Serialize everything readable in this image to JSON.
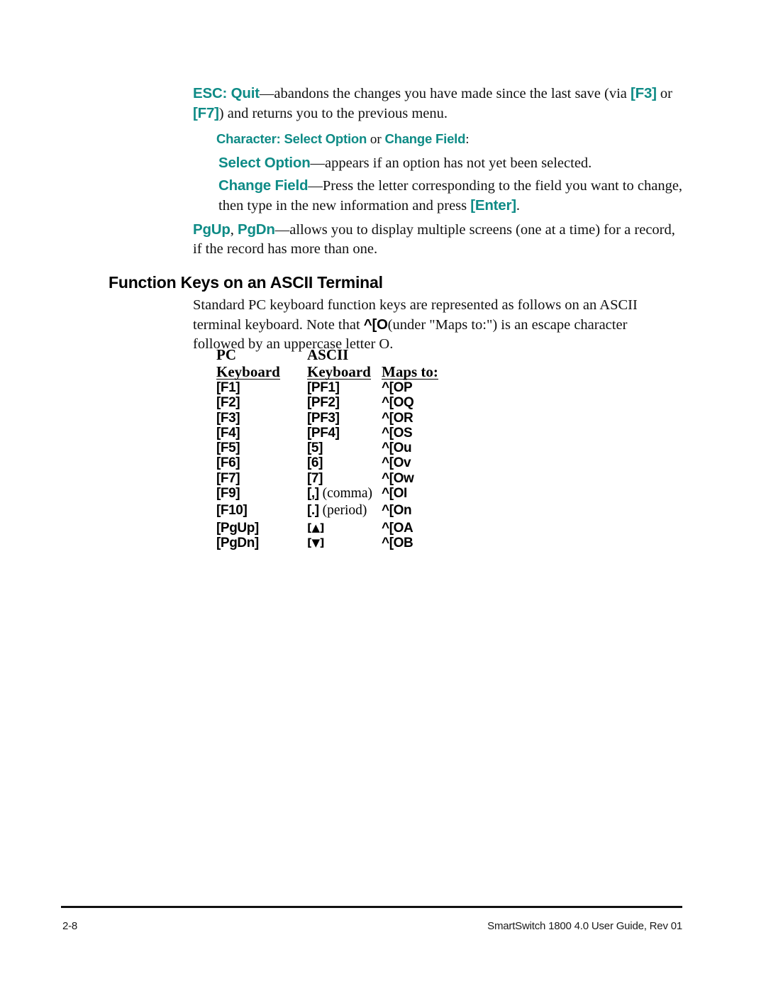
{
  "document": {
    "page_number": "2-8",
    "footer_reference": "SmartSwitch 1800 4.0 User Guide, Rev 01",
    "accent_color": "#0e8b86",
    "text_color": "#000000",
    "background_color": "#ffffff"
  },
  "esc_paragraph": {
    "key_label": "ESC: Quit",
    "text_1": "—abandons the changes you have made since the last save (via ",
    "key_f3": "[F3]",
    "text_or": " or ",
    "key_f7": "[F7]",
    "text_2": ") and returns you to the previous menu."
  },
  "character_heading": {
    "prefix": "Character: Select Option",
    "connector": " or ",
    "suffix": "Change Field",
    "colon": ":"
  },
  "select_option_paragraph": {
    "key_label": "Select Option",
    "text": "—appears if an option has not yet been selected."
  },
  "change_field_paragraph": {
    "key_label": "Change Field",
    "text_1": "—Press the letter corresponding to the field you want to change, then type in the new information and press ",
    "key_enter": "[Enter]",
    "text_2": "."
  },
  "pgup_pgdn_paragraph": {
    "key_pgup": "PgUp",
    "comma": ", ",
    "key_pgdn": "PgDn",
    "text": "—allows you to display multiple screens (one at a time) for a record, if the record has more than one."
  },
  "section": {
    "heading": "Function Keys on an ASCII Terminal",
    "intro_1": "Standard PC keyboard function keys are represented as follows on an ASCII terminal keyboard. Note that ",
    "intro_escape": "^[O",
    "intro_2": "(under \"Maps to:\") is an escape character followed by an uppercase letter O."
  },
  "key_table": {
    "headers_top": [
      "PC",
      "ASCII",
      ""
    ],
    "headers_bottom": [
      "Keyboard",
      "Keyboard",
      "Maps to:"
    ],
    "rows": [
      {
        "pc": "[F1]",
        "ascii": "[PF1]",
        "ascii_note": "",
        "maps": "^[OP",
        "gap": false
      },
      {
        "pc": "[F2]",
        "ascii": "[PF2]",
        "ascii_note": "",
        "maps": "^[OQ",
        "gap": false
      },
      {
        "pc": "[F3]",
        "ascii": "[PF3]",
        "ascii_note": "",
        "maps": "^[OR",
        "gap": false
      },
      {
        "pc": "[F4]",
        "ascii": "[PF4]",
        "ascii_note": "",
        "maps": "^[OS",
        "gap": false
      },
      {
        "pc": "[F5]",
        "ascii": "[5]",
        "ascii_note": "",
        "maps": "^[Ou",
        "gap": false
      },
      {
        "pc": "[F6]",
        "ascii": "[6]",
        "ascii_note": "",
        "maps": "^[Ov",
        "gap": false
      },
      {
        "pc": "[F7]",
        "ascii": "[7]",
        "ascii_note": "",
        "maps": "^[Ow",
        "gap": false
      },
      {
        "pc": "[F9]",
        "ascii": "[,]",
        "ascii_note": " (comma)",
        "maps": "^[OI",
        "gap": false
      },
      {
        "pc": "[F10]",
        "ascii": "[.]",
        "ascii_note": " (period)",
        "maps": "^[On",
        "gap": true
      },
      {
        "pc": "[PgUp]",
        "ascii": "[▲]",
        "ascii_note": "",
        "maps": "^[OA",
        "gap": true
      },
      {
        "pc": "[PgDn]",
        "ascii": "[▼]",
        "ascii_note": "",
        "maps": "^[OB",
        "gap": false
      }
    ]
  }
}
